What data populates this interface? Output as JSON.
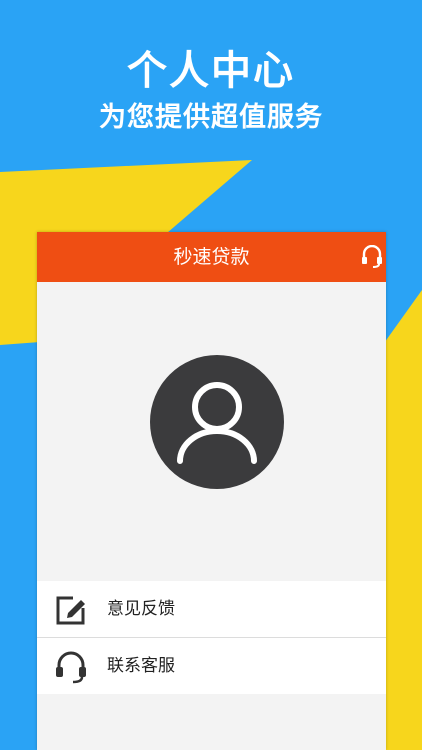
{
  "promo": {
    "title": "个人中心",
    "subtitle": "为您提供超值服务"
  },
  "app": {
    "title": "秒速贷款",
    "header_icon": "customer-service-icon"
  },
  "profile": {
    "avatar_icon": "user-avatar-icon"
  },
  "menu": {
    "items": [
      {
        "label": "意见反馈",
        "icon": "edit-icon"
      },
      {
        "label": "联系客服",
        "icon": "headset-icon"
      }
    ]
  },
  "colors": {
    "sky_blue": "#2aa3f5",
    "yellow": "#f7d61c",
    "accent_orange": "#ef4e13",
    "avatar_dark": "#3b3b3d"
  }
}
